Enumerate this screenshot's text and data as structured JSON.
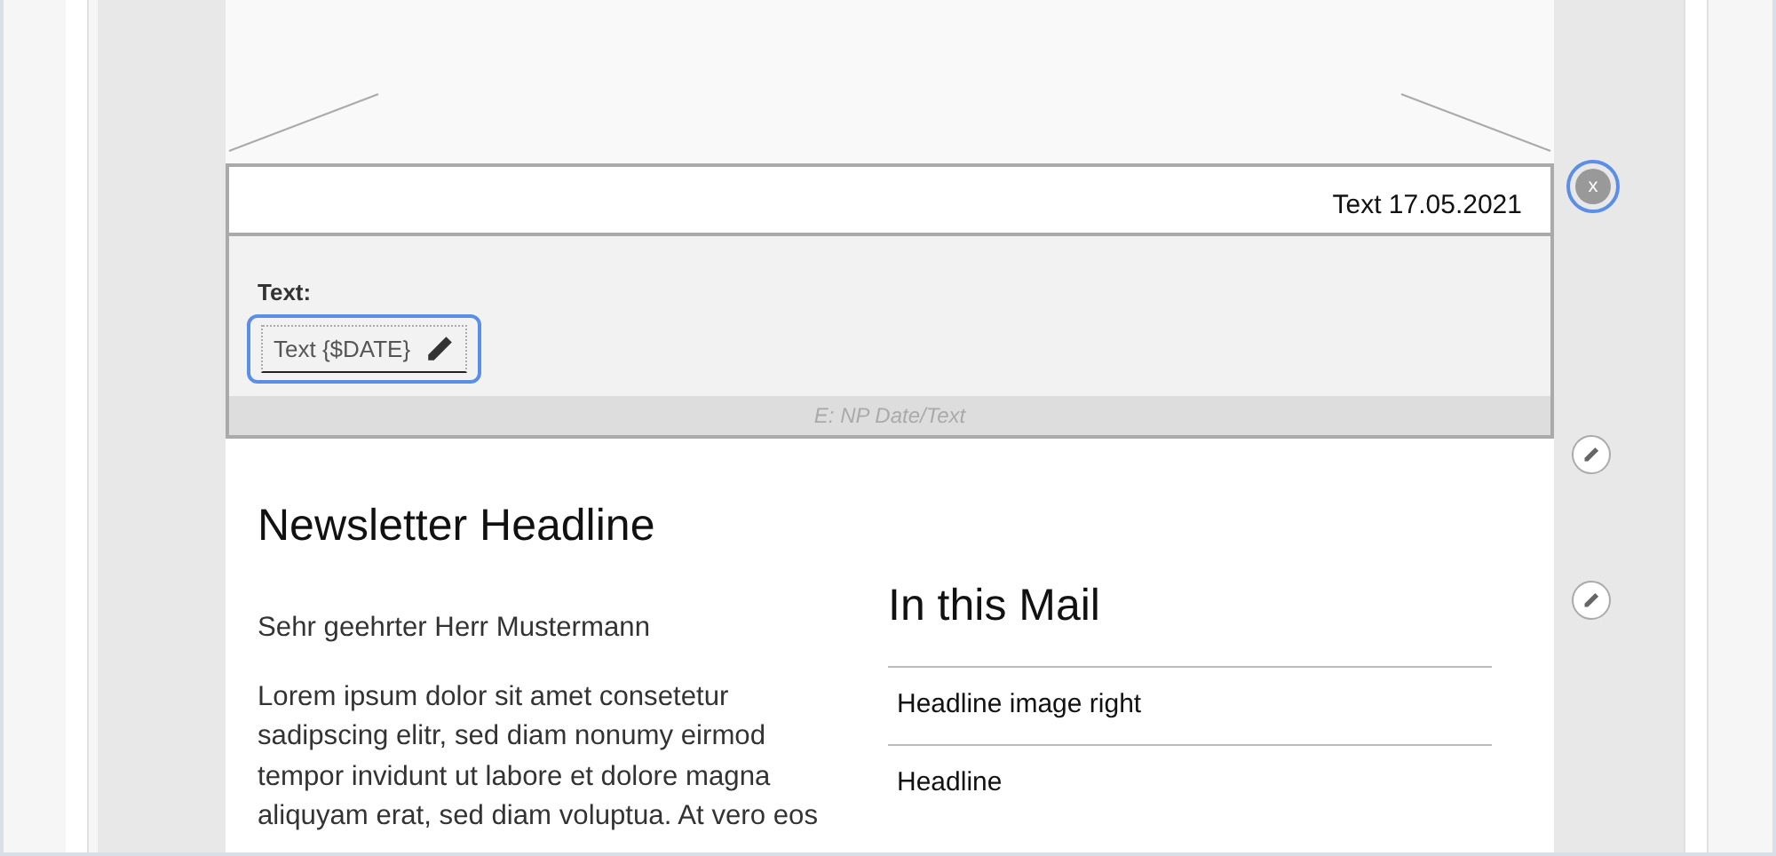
{
  "date_block": {
    "preview_text": "Text 17.05.2021",
    "field_label": "Text:",
    "field_value": "Text {$DATE}",
    "field_focused": true,
    "element_name": "E: NP Date/Text"
  },
  "remove_button": {
    "label": "x",
    "highlighted": true
  },
  "headline": "Newsletter Headline",
  "salutation": "Sehr geehrter Herr Mustermann",
  "body": "Lorem ipsum dolor sit amet consetetur sadipscing elitr, sed diam nonumy eirmod tempor invidunt ut labore et dolore magna aliquyam erat, sed diam voluptua. At vero eos",
  "toc": {
    "title": "In this Mail",
    "items": [
      "Headline image right",
      "Headline"
    ]
  }
}
